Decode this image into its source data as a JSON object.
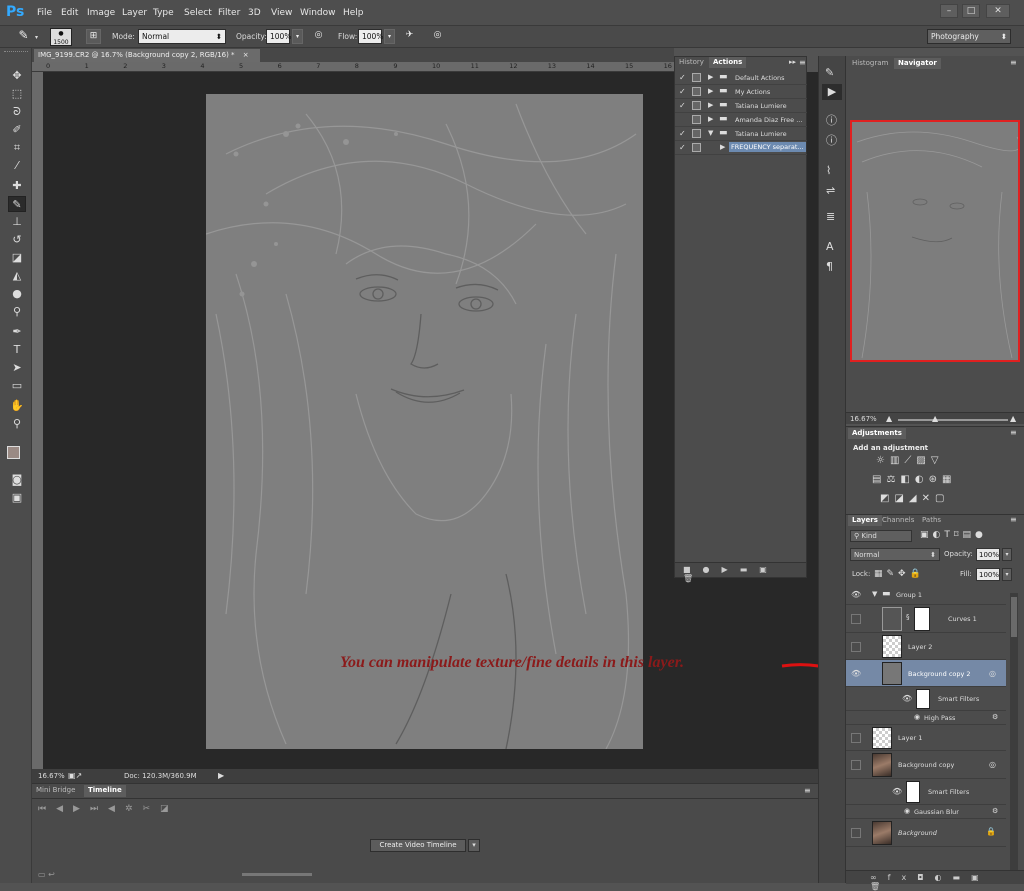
{
  "app": {
    "logo": "Ps",
    "workspace": "Photography"
  },
  "menu": [
    "File",
    "Edit",
    "Image",
    "Layer",
    "Type",
    "Select",
    "Filter",
    "3D",
    "View",
    "Window",
    "Help"
  ],
  "window_controls": [
    "–",
    "□",
    "✕"
  ],
  "options": {
    "brush_size": "1500",
    "mode_label": "Mode:",
    "mode_value": "Normal",
    "opacity_label": "Opacity:",
    "opacity_value": "100%",
    "flow_label": "Flow:",
    "flow_value": "100%"
  },
  "document": {
    "tab_title": "IMG_9199.CR2 @ 16.7% (Background copy 2, RGB/16) *",
    "close": "×",
    "ruler_marks": [
      "0",
      "1",
      "2",
      "3",
      "4",
      "5",
      "6",
      "7",
      "8",
      "9",
      "10",
      "11",
      "12",
      "13",
      "14",
      "15",
      "16"
    ]
  },
  "status": {
    "zoom": "16.67%",
    "doc_size": "Doc: 120.3M/360.9M"
  },
  "timeline": {
    "tabs": [
      "Mini Bridge",
      "Timeline"
    ],
    "active_tab": "Timeline",
    "create_button": "Create Video Timeline"
  },
  "actions_panel": {
    "tabs": [
      "History",
      "Actions"
    ],
    "active_tab": "Actions",
    "rows": [
      {
        "label": "Default Actions",
        "expanded": false,
        "indent": 0,
        "selected": false,
        "checked": true
      },
      {
        "label": "My Actions",
        "expanded": false,
        "indent": 0,
        "selected": false,
        "checked": true
      },
      {
        "label": "Tatiana Lumiere",
        "expanded": false,
        "indent": 0,
        "selected": false,
        "checked": true
      },
      {
        "label": "Amanda Diaz Free ...",
        "expanded": false,
        "indent": 0,
        "selected": false,
        "checked": false
      },
      {
        "label": "Tatiana Lumiere",
        "expanded": true,
        "indent": 0,
        "selected": false,
        "checked": true
      },
      {
        "label": "FREQUENCY separat...",
        "expanded": false,
        "indent": 1,
        "selected": true,
        "checked": true
      }
    ]
  },
  "navigator": {
    "tabs": [
      "Histogram",
      "Navigator"
    ],
    "active_tab": "Navigator",
    "zoom": "16.67%"
  },
  "adjustments": {
    "tab": "Adjustments",
    "hint": "Add an adjustment"
  },
  "layers_panel": {
    "tabs": [
      "Layers",
      "Channels",
      "Paths"
    ],
    "active_tab": "Layers",
    "filter_kind": "Kind",
    "blend_mode": "Normal",
    "opacity_label": "Opacity:",
    "opacity_value": "100%",
    "lock_label": "Lock:",
    "fill_label": "Fill:",
    "fill_value": "100%",
    "layers": [
      {
        "name": "Group 1",
        "kind": "group",
        "visible": true,
        "selected": false,
        "indent": 0,
        "row": 20
      },
      {
        "name": "Curves 1",
        "kind": "adjustment",
        "visible": false,
        "selected": false,
        "indent": 1,
        "row": 28
      },
      {
        "name": "Layer 2",
        "kind": "transparent",
        "visible": false,
        "selected": false,
        "indent": 1,
        "row": 27
      },
      {
        "name": "Background copy 2",
        "kind": "smart",
        "visible": true,
        "selected": true,
        "indent": 1,
        "row": 27
      },
      {
        "name": "Smart Filters",
        "kind": "smartfilters",
        "visible": true,
        "selected": false,
        "indent": 2,
        "row": 24
      },
      {
        "name": "High Pass",
        "kind": "filter",
        "visible": true,
        "selected": false,
        "indent": 2,
        "row": 14
      },
      {
        "name": "Layer 1",
        "kind": "transparent",
        "visible": false,
        "selected": false,
        "indent": 0,
        "row": 26
      },
      {
        "name": "Background copy",
        "kind": "smartphoto",
        "visible": false,
        "selected": false,
        "indent": 0,
        "row": 28
      },
      {
        "name": "Smart Filters",
        "kind": "smartfilters",
        "visible": true,
        "selected": false,
        "indent": 1,
        "row": 26
      },
      {
        "name": "Gaussian Blur",
        "kind": "filter",
        "visible": true,
        "selected": false,
        "indent": 1,
        "row": 14
      },
      {
        "name": "Background",
        "kind": "photo",
        "visible": false,
        "selected": false,
        "indent": 0,
        "row": 28
      }
    ]
  },
  "annotation": "You can manipulate texture/fine details in this layer."
}
